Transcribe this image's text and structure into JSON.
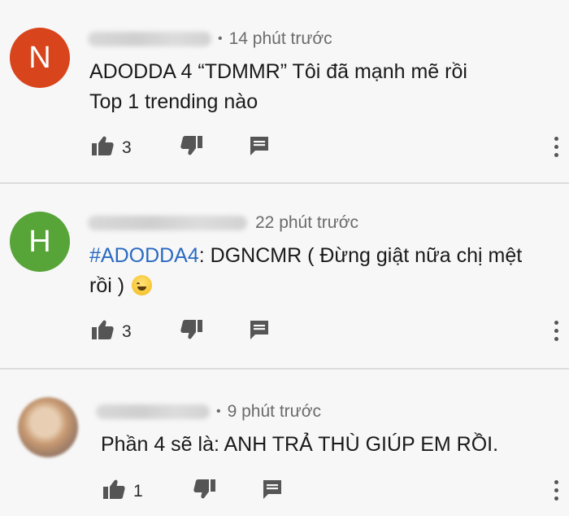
{
  "comments": [
    {
      "avatar_letter": "N",
      "avatar_color": "#d8441c",
      "time": "14 phút trước",
      "line1": "ADODDA 4 “TDMMR” Tôi đã mạnh mẽ rồi",
      "line2": "Top 1 trending nào",
      "likes": "3"
    },
    {
      "avatar_letter": "H",
      "avatar_color": "#57a438",
      "time": "22 phút trước",
      "hashtag": "#ADODDA4",
      "line1_rest": ": DGNCMR ( Đừng giật nữa chị mệt",
      "line2": "rồi ) ",
      "emoji": "sweat-smile-emoji",
      "likes": "3"
    },
    {
      "avatar_kind": "photo",
      "time": "9 phút trước",
      "line1": "Phần 4 sẽ là: ANH TRẢ THÙ GIÚP EM RỒI.",
      "likes": "1"
    }
  ],
  "icons": [
    "like-icon",
    "dislike-icon",
    "reply-icon",
    "more-options-icon"
  ],
  "colors": {
    "hashtag": "#2a6ac2",
    "meta_text": "#6b6b6b"
  }
}
